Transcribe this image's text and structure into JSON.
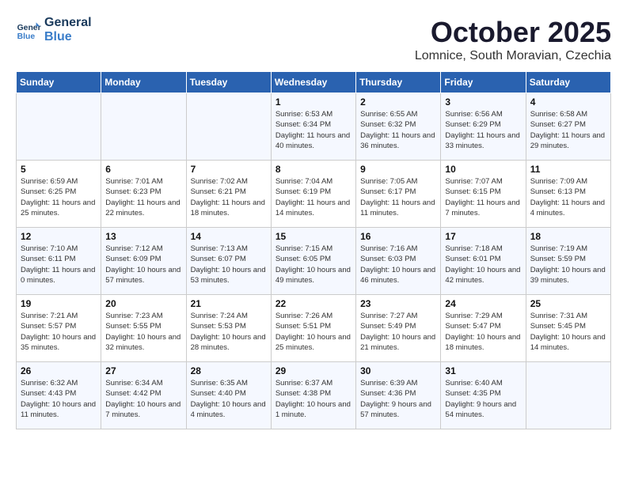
{
  "logo": {
    "line1": "General",
    "line2": "Blue"
  },
  "title": "October 2025",
  "subtitle": "Lomnice, South Moravian, Czechia",
  "weekdays": [
    "Sunday",
    "Monday",
    "Tuesday",
    "Wednesday",
    "Thursday",
    "Friday",
    "Saturday"
  ],
  "weeks": [
    [
      {
        "day": "",
        "info": ""
      },
      {
        "day": "",
        "info": ""
      },
      {
        "day": "",
        "info": ""
      },
      {
        "day": "1",
        "info": "Sunrise: 6:53 AM\nSunset: 6:34 PM\nDaylight: 11 hours\nand 40 minutes."
      },
      {
        "day": "2",
        "info": "Sunrise: 6:55 AM\nSunset: 6:32 PM\nDaylight: 11 hours\nand 36 minutes."
      },
      {
        "day": "3",
        "info": "Sunrise: 6:56 AM\nSunset: 6:29 PM\nDaylight: 11 hours\nand 33 minutes."
      },
      {
        "day": "4",
        "info": "Sunrise: 6:58 AM\nSunset: 6:27 PM\nDaylight: 11 hours\nand 29 minutes."
      }
    ],
    [
      {
        "day": "5",
        "info": "Sunrise: 6:59 AM\nSunset: 6:25 PM\nDaylight: 11 hours\nand 25 minutes."
      },
      {
        "day": "6",
        "info": "Sunrise: 7:01 AM\nSunset: 6:23 PM\nDaylight: 11 hours\nand 22 minutes."
      },
      {
        "day": "7",
        "info": "Sunrise: 7:02 AM\nSunset: 6:21 PM\nDaylight: 11 hours\nand 18 minutes."
      },
      {
        "day": "8",
        "info": "Sunrise: 7:04 AM\nSunset: 6:19 PM\nDaylight: 11 hours\nand 14 minutes."
      },
      {
        "day": "9",
        "info": "Sunrise: 7:05 AM\nSunset: 6:17 PM\nDaylight: 11 hours\nand 11 minutes."
      },
      {
        "day": "10",
        "info": "Sunrise: 7:07 AM\nSunset: 6:15 PM\nDaylight: 11 hours\nand 7 minutes."
      },
      {
        "day": "11",
        "info": "Sunrise: 7:09 AM\nSunset: 6:13 PM\nDaylight: 11 hours\nand 4 minutes."
      }
    ],
    [
      {
        "day": "12",
        "info": "Sunrise: 7:10 AM\nSunset: 6:11 PM\nDaylight: 11 hours\nand 0 minutes."
      },
      {
        "day": "13",
        "info": "Sunrise: 7:12 AM\nSunset: 6:09 PM\nDaylight: 10 hours\nand 57 minutes."
      },
      {
        "day": "14",
        "info": "Sunrise: 7:13 AM\nSunset: 6:07 PM\nDaylight: 10 hours\nand 53 minutes."
      },
      {
        "day": "15",
        "info": "Sunrise: 7:15 AM\nSunset: 6:05 PM\nDaylight: 10 hours\nand 49 minutes."
      },
      {
        "day": "16",
        "info": "Sunrise: 7:16 AM\nSunset: 6:03 PM\nDaylight: 10 hours\nand 46 minutes."
      },
      {
        "day": "17",
        "info": "Sunrise: 7:18 AM\nSunset: 6:01 PM\nDaylight: 10 hours\nand 42 minutes."
      },
      {
        "day": "18",
        "info": "Sunrise: 7:19 AM\nSunset: 5:59 PM\nDaylight: 10 hours\nand 39 minutes."
      }
    ],
    [
      {
        "day": "19",
        "info": "Sunrise: 7:21 AM\nSunset: 5:57 PM\nDaylight: 10 hours\nand 35 minutes."
      },
      {
        "day": "20",
        "info": "Sunrise: 7:23 AM\nSunset: 5:55 PM\nDaylight: 10 hours\nand 32 minutes."
      },
      {
        "day": "21",
        "info": "Sunrise: 7:24 AM\nSunset: 5:53 PM\nDaylight: 10 hours\nand 28 minutes."
      },
      {
        "day": "22",
        "info": "Sunrise: 7:26 AM\nSunset: 5:51 PM\nDaylight: 10 hours\nand 25 minutes."
      },
      {
        "day": "23",
        "info": "Sunrise: 7:27 AM\nSunset: 5:49 PM\nDaylight: 10 hours\nand 21 minutes."
      },
      {
        "day": "24",
        "info": "Sunrise: 7:29 AM\nSunset: 5:47 PM\nDaylight: 10 hours\nand 18 minutes."
      },
      {
        "day": "25",
        "info": "Sunrise: 7:31 AM\nSunset: 5:45 PM\nDaylight: 10 hours\nand 14 minutes."
      }
    ],
    [
      {
        "day": "26",
        "info": "Sunrise: 6:32 AM\nSunset: 4:43 PM\nDaylight: 10 hours\nand 11 minutes."
      },
      {
        "day": "27",
        "info": "Sunrise: 6:34 AM\nSunset: 4:42 PM\nDaylight: 10 hours\nand 7 minutes."
      },
      {
        "day": "28",
        "info": "Sunrise: 6:35 AM\nSunset: 4:40 PM\nDaylight: 10 hours\nand 4 minutes."
      },
      {
        "day": "29",
        "info": "Sunrise: 6:37 AM\nSunset: 4:38 PM\nDaylight: 10 hours\nand 1 minute."
      },
      {
        "day": "30",
        "info": "Sunrise: 6:39 AM\nSunset: 4:36 PM\nDaylight: 9 hours\nand 57 minutes."
      },
      {
        "day": "31",
        "info": "Sunrise: 6:40 AM\nSunset: 4:35 PM\nDaylight: 9 hours\nand 54 minutes."
      },
      {
        "day": "",
        "info": ""
      }
    ]
  ]
}
